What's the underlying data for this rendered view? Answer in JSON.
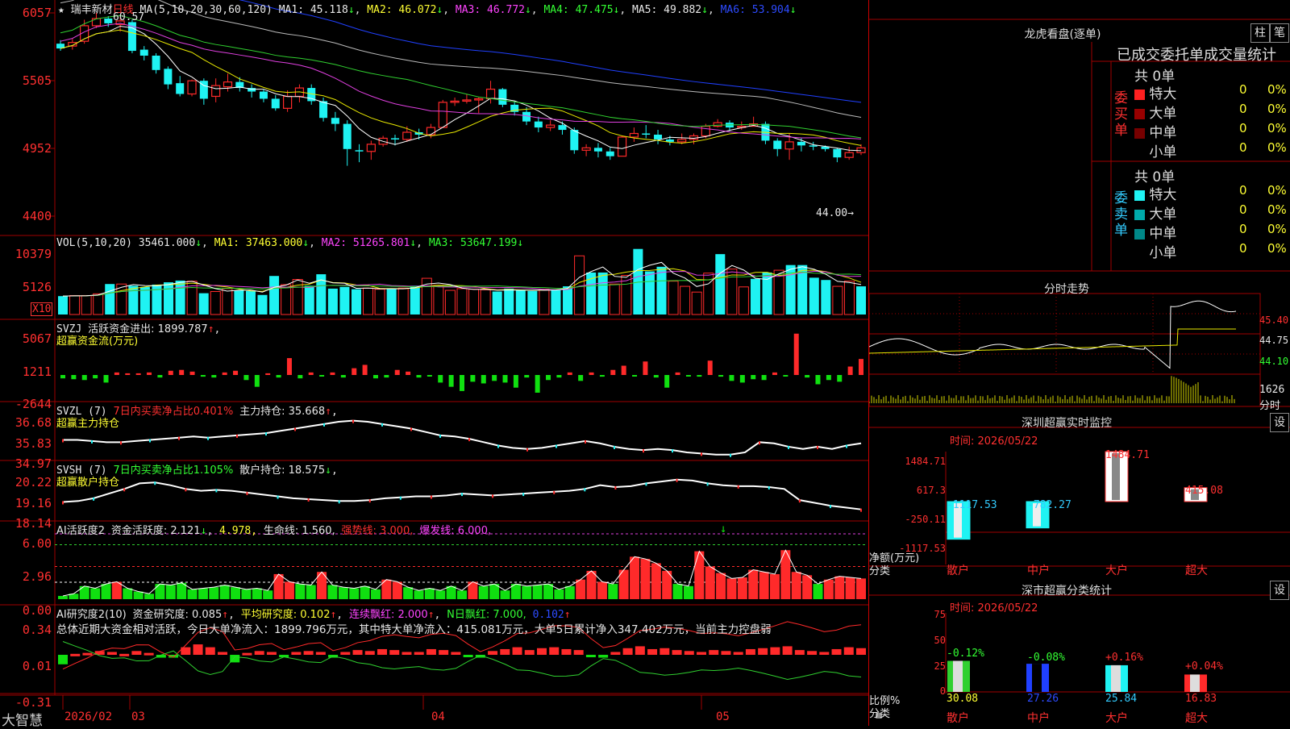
{
  "stock": {
    "name": "瑞丰新材",
    "period": "日线",
    "star": "★"
  },
  "colors": {
    "up": "#ff2a2a",
    "down": "#1ff3f3",
    "ma1": "#ffffff",
    "ma2": "#e8e800",
    "ma3": "#e040e0",
    "ma4": "#30d030",
    "ma5": "#bbbbbb",
    "ma6": "#2040ff",
    "grid": "#a00000"
  },
  "kline": {
    "header": {
      "ma_params": "MA(5,10,20,30,60,120)",
      "ma1": "MA1: 45.118",
      "ma2": "MA2: 46.072",
      "ma3": "MA3: 46.772",
      "ma4": "MA4: 47.475",
      "ma5": "MA5: 49.882",
      "ma6": "MA6: 53.904",
      "arrow": "↓"
    },
    "ylabels": [
      "6057",
      "5505",
      "4952",
      "4400"
    ],
    "high_label": "60.57",
    "low_label": "44.00→"
  },
  "vol": {
    "header": {
      "name": "VOL(5,10,20)",
      "v": "35461.000",
      "ma1": "MA1: 37463.000",
      "ma2": "MA2: 51265.801",
      "ma3": "MA3: 53647.199",
      "arrow": "↓"
    },
    "ylabels": [
      "10379",
      "5126"
    ],
    "unit": "X10"
  },
  "svzj": {
    "header": {
      "name": "SVZJ",
      "label": "活跃资金进出: 1899.787",
      "arrow": "↑",
      "sub": "超赢资金流(万元)"
    },
    "ylabels": [
      "5067",
      "1211",
      "-2644"
    ]
  },
  "svzl": {
    "header": {
      "name": "SVZL (7)",
      "label1": "7日内买卖净占比0.401%",
      "label2": "主力持仓: 35.668",
      "arrow": "↑",
      "comma": ",",
      "sub": "超赢主力持仓"
    },
    "ylabels": [
      "36.68",
      "35.83",
      "34.97"
    ]
  },
  "svsh": {
    "header": {
      "name": "SVSH (7)",
      "label1": "7日内买卖净占比1.105%",
      "label2": "散户持仓: 18.575",
      "arrow": "↓",
      "comma": ",",
      "sub": "超赢散户持仓"
    },
    "ylabels": [
      "20.22",
      "19.16",
      "18.14"
    ]
  },
  "ai1": {
    "header": {
      "name": "AI活跃度2",
      "label": "资金活跃度: 2.121",
      "arrow": "↓",
      "v2": "4.978,",
      "life": "生命线: 1.560,",
      "strong": "强势线: 3.000,",
      "burst": "爆发线: 6.000,"
    },
    "ylabels": [
      "6.00",
      "2.96",
      "0.00"
    ]
  },
  "ai2": {
    "header": {
      "name": "AI研究度2(10)",
      "label": "资金研究度: 0.085",
      "avg": "平均研究度: 0.102",
      "cont": "连续飘红: 2.000",
      "nday": "N日飘红: 7.000,",
      "last": "0.102",
      "arrow": "↑"
    },
    "summary": "总体近期大资金相对活跃，今日大单净流入：1899.796万元，其中特大单净流入：415.081万元，大单5日累计净入347.402万元，当前主力控盘弱",
    "ylabels": [
      "0.34",
      "0.01",
      "-0.31"
    ]
  },
  "xaxis": {
    "brand": "大智慧",
    "labels": [
      "2026/02",
      "03",
      "04",
      "05"
    ]
  },
  "right": {
    "dragon_title": "龙虎看盘(逐单)",
    "btn_zhu": "柱",
    "btn_bi": "笔",
    "stats_title": "已成交委托单成交量统计",
    "buy": {
      "side": "委买单",
      "total": "共 0单",
      "rows": [
        {
          "label": "特大",
          "v": "0",
          "p": "0%"
        },
        {
          "label": "大单",
          "v": "0",
          "p": "0%"
        },
        {
          "label": "中单",
          "v": "0",
          "p": "0%"
        },
        {
          "label": "小单",
          "v": "0",
          "p": "0%"
        }
      ]
    },
    "sell": {
      "side": "委卖单",
      "total": "共 0单",
      "rows": [
        {
          "label": "特大",
          "v": "0",
          "p": "0%"
        },
        {
          "label": "大单",
          "v": "0",
          "p": "0%"
        },
        {
          "label": "中单",
          "v": "0",
          "p": "0%"
        },
        {
          "label": "小单",
          "v": "0",
          "p": "0%"
        }
      ]
    },
    "intraday_title": "分时走势",
    "intraday_ylabels": [
      "45.40",
      "44.75",
      "44.10"
    ],
    "intraday_vol_label": "1626",
    "intraday_vol_unit": "分时",
    "monitor_title": "深圳超赢实时监控",
    "monitor_time": "时间: 2026/05/22",
    "monitor_ylabels": [
      "1484.71",
      "617.3",
      "-250.11",
      "-1117.53"
    ],
    "monitor_unit1": "净额(万元)",
    "monitor_unit2": "分类",
    "monitor_bars": [
      {
        "cat": "散户",
        "value": -1117.53,
        "label": "-1117.53"
      },
      {
        "cat": "中户",
        "value": -782.27,
        "label": "-782.27"
      },
      {
        "cat": "大户",
        "value": 1484.71,
        "label": "1484.71"
      },
      {
        "cat": "超大",
        "value": 415.08,
        "label": "415.08"
      }
    ],
    "class_title": "深市超赢分类统计",
    "class_time": "时间: 2026/05/22",
    "class_ylabels": [
      "75",
      "50",
      "25",
      "0"
    ],
    "class_unit1": "比例%",
    "class_unit2": "分类",
    "class_bars": [
      {
        "cat": "散户",
        "value": 30.08,
        "label": "30.08",
        "chg": "-0.12%"
      },
      {
        "cat": "中户",
        "value": 27.26,
        "label": "27.26",
        "chg": "-0.08%"
      },
      {
        "cat": "大户",
        "value": 25.84,
        "label": "25.84",
        "chg": "+0.16%"
      },
      {
        "cat": "超大",
        "value": 16.83,
        "label": "16.83",
        "chg": "+0.04%"
      }
    ],
    "btn_set": "设"
  },
  "chart_data": [
    {
      "type": "candlestick",
      "title": "瑞丰新材 日线",
      "ylim": [
        44.0,
        60.57
      ],
      "candles": [
        [
          58.0,
          57.6,
          58.3,
          57.4
        ],
        [
          57.8,
          58.1,
          58.4,
          57.5
        ],
        [
          58.2,
          59.5,
          60.0,
          58.0
        ],
        [
          59.5,
          60.1,
          60.57,
          59.3
        ],
        [
          60.1,
          59.7,
          60.3,
          59.4
        ],
        [
          59.6,
          59.9,
          60.2,
          59.0
        ],
        [
          59.8,
          57.4,
          60.0,
          57.2
        ],
        [
          57.5,
          57.0,
          57.8,
          56.6
        ],
        [
          57.0,
          55.8,
          57.2,
          55.5
        ],
        [
          55.9,
          54.6,
          56.1,
          54.2
        ],
        [
          54.7,
          53.8,
          55.3,
          53.6
        ],
        [
          53.8,
          54.9,
          55.0,
          53.6
        ],
        [
          54.9,
          53.4,
          55.1,
          52.9
        ],
        [
          53.6,
          54.5,
          55.1,
          53.1
        ],
        [
          54.4,
          54.8,
          55.5,
          54.0
        ],
        [
          54.8,
          54.3,
          55.2,
          54.0
        ],
        [
          54.3,
          54.0,
          54.6,
          53.5
        ],
        [
          54.0,
          53.4,
          54.2,
          53.1
        ],
        [
          53.4,
          52.6,
          53.7,
          52.4
        ],
        [
          52.6,
          53.6,
          54.1,
          52.3
        ],
        [
          53.6,
          54.3,
          54.6,
          53.1
        ],
        [
          54.3,
          53.2,
          54.6,
          52.9
        ],
        [
          53.2,
          51.8,
          53.5,
          51.5
        ],
        [
          51.8,
          51.3,
          52.3,
          50.7
        ],
        [
          51.3,
          49.2,
          51.6,
          47.8
        ],
        [
          49.1,
          49.0,
          49.6,
          48.1
        ],
        [
          49.0,
          49.6,
          49.9,
          48.3
        ],
        [
          49.6,
          50.1,
          50.3,
          49.4
        ],
        [
          50.1,
          50.0,
          50.4,
          49.5
        ],
        [
          50.0,
          50.6,
          51.1,
          49.8
        ],
        [
          50.6,
          50.4,
          50.9,
          50.0
        ],
        [
          50.4,
          51.0,
          51.3,
          50.1
        ],
        [
          51.0,
          53.1,
          53.3,
          51.0
        ],
        [
          53.1,
          53.2,
          53.5,
          52.8
        ],
        [
          53.2,
          53.3,
          53.8,
          53.0
        ],
        [
          53.3,
          53.4,
          53.5,
          52.2
        ],
        [
          53.4,
          54.2,
          54.9,
          53.0
        ],
        [
          54.2,
          52.9,
          54.3,
          52.7
        ],
        [
          52.9,
          52.3,
          53.2,
          52.0
        ],
        [
          52.3,
          51.5,
          52.7,
          51.2
        ],
        [
          51.5,
          51.0,
          51.9,
          50.6
        ],
        [
          51.0,
          51.2,
          51.6,
          50.7
        ],
        [
          51.2,
          50.8,
          51.5,
          50.4
        ],
        [
          50.8,
          49.1,
          51.0,
          48.8
        ],
        [
          49.1,
          49.3,
          49.6,
          48.6
        ],
        [
          49.3,
          49.0,
          49.7,
          48.5
        ],
        [
          49.0,
          48.6,
          49.3,
          48.3
        ],
        [
          48.6,
          50.2,
          50.3,
          48.6
        ],
        [
          50.2,
          50.5,
          51.0,
          49.8
        ],
        [
          50.5,
          50.4,
          51.2,
          50.1
        ],
        [
          50.4,
          50.0,
          50.8,
          49.6
        ],
        [
          50.0,
          49.8,
          50.3,
          49.5
        ],
        [
          49.8,
          50.0,
          50.5,
          49.6
        ],
        [
          50.0,
          50.3,
          50.5,
          49.6
        ],
        [
          50.3,
          51.1,
          51.3,
          50.1
        ],
        [
          51.1,
          51.4,
          51.7,
          51.0
        ],
        [
          51.4,
          51.0,
          51.6,
          50.7
        ],
        [
          51.0,
          51.1,
          51.5,
          50.8
        ],
        [
          51.1,
          51.3,
          51.9,
          51.1
        ],
        [
          51.3,
          49.9,
          51.5,
          49.6
        ],
        [
          49.9,
          49.2,
          50.1,
          48.6
        ],
        [
          49.2,
          49.8,
          50.5,
          48.3
        ],
        [
          49.8,
          49.5,
          50.1,
          49.0
        ],
        [
          49.5,
          49.4,
          49.8,
          49.1
        ],
        [
          49.4,
          49.2,
          49.5,
          49.0
        ],
        [
          49.2,
          48.5,
          49.3,
          48.1
        ],
        [
          48.5,
          48.9,
          49.4,
          48.3
        ],
        [
          48.9,
          49.3,
          49.6,
          48.7
        ]
      ],
      "ma_lines": [
        "MA1",
        "MA2",
        "MA3",
        "MA4",
        "MA5",
        "MA6"
      ]
    },
    {
      "type": "bar",
      "title": "VOL(5,10,20)",
      "values": [
        3.2,
        3.3,
        3.3,
        3.6,
        5.3,
        5.3,
        5.0,
        4.8,
        5.2,
        5.6,
        5.9,
        5.8,
        3.7,
        4.0,
        4.5,
        4.2,
        4.1,
        3.4,
        6.7,
        5.2,
        6.1,
        5.0,
        7.0,
        4.5,
        4.8,
        4.4,
        4.6,
        4.4,
        4.4,
        4.6,
        5.0,
        6.3,
        5.1,
        4.2,
        4.5,
        4.4,
        4.3,
        4.0,
        4.5,
        4.2,
        4.1,
        4.4,
        4.3,
        4.9,
        10.2,
        7.3,
        7.3,
        5.3,
        6.8,
        11.4,
        7.5,
        8.3,
        5.8,
        4.9,
        3.9,
        7.2,
        10.5,
        7.9,
        4.8,
        6.2,
        7.3,
        7.7,
        8.6,
        8.6,
        6.4,
        6.0,
        4.9,
        5.8,
        4.9
      ],
      "series": [
        {
          "name": "MA1"
        },
        {
          "name": "MA2"
        },
        {
          "name": "MA3"
        }
      ]
    },
    {
      "type": "bar",
      "title": "SVZJ 超赢资金流(万元)",
      "values": [
        -400,
        -500,
        -600,
        -400,
        -900,
        300,
        200,
        200,
        300,
        -300,
        500,
        600,
        400,
        -200,
        -300,
        300,
        500,
        -600,
        -1400,
        200,
        -300,
        2000,
        -400,
        300,
        -100,
        300,
        -300,
        800,
        1200,
        -400,
        -300,
        600,
        400,
        -300,
        -100,
        -900,
        -1400,
        -1900,
        -800,
        -1000,
        -700,
        -900,
        -1500,
        -300,
        -2100,
        -600,
        -300,
        300,
        -700,
        300,
        -200,
        600,
        1100,
        -100,
        1600,
        -300,
        -1500,
        300,
        -100,
        -200,
        1700,
        -200,
        -700,
        -900,
        -500,
        -600,
        300,
        -100,
        4900,
        -300,
        -1100,
        -600,
        -800,
        1000,
        1900
      ]
    },
    {
      "type": "line",
      "title": "SVZL 超赢主力持仓",
      "ylim": [
        34.97,
        36.68
      ],
      "values": [
        35.7,
        35.7,
        35.65,
        35.6,
        35.6,
        35.65,
        35.7,
        35.75,
        35.8,
        35.85,
        35.8,
        35.85,
        35.9,
        35.95,
        36.0,
        36.1,
        36.2,
        36.3,
        36.4,
        36.5,
        36.55,
        36.5,
        36.4,
        36.3,
        36.2,
        36.05,
        35.9,
        35.85,
        35.75,
        35.6,
        35.45,
        35.35,
        35.3,
        35.35,
        35.45,
        35.55,
        35.65,
        35.55,
        35.4,
        35.3,
        35.25,
        35.3,
        35.25,
        35.15,
        35.1,
        35.05,
        35.05,
        35.15,
        35.6,
        35.55,
        35.4,
        35.3,
        35.4,
        35.3,
        35.45,
        35.55
      ]
    },
    {
      "type": "line",
      "title": "SVSH 超赢散户持仓",
      "ylim": [
        18.14,
        20.22
      ],
      "values": [
        18.9,
        18.95,
        19.1,
        19.35,
        19.6,
        19.9,
        19.95,
        19.8,
        19.6,
        19.5,
        19.55,
        19.5,
        19.4,
        19.3,
        19.2,
        19.1,
        19.05,
        19.0,
        18.95,
        18.95,
        19.0,
        19.1,
        19.15,
        19.2,
        19.2,
        19.25,
        19.35,
        19.3,
        19.25,
        19.3,
        19.35,
        19.4,
        19.45,
        19.5,
        19.6,
        19.8,
        19.7,
        19.75,
        19.9,
        20.0,
        20.1,
        20.05,
        19.9,
        19.8,
        19.75,
        19.75,
        19.7,
        19.6,
        19.0,
        18.85,
        18.7,
        18.6,
        18.5
      ]
    },
    {
      "type": "bar",
      "title": "AI活跃度2",
      "ylim": [
        0,
        6
      ],
      "values": [
        0.3,
        0.5,
        1.2,
        1.0,
        1.4,
        1.6,
        1.0,
        0.7,
        0.5,
        1.4,
        1.3,
        1.5,
        0.9,
        1.0,
        1.1,
        1.3,
        1.1,
        0.9,
        1.0,
        0.8,
        2.3,
        1.6,
        1.4,
        1.3,
        2.5,
        1.3,
        1.1,
        1.0,
        1.2,
        0.9,
        1.8,
        1.6,
        1.1,
        0.8,
        1.0,
        0.8,
        1.2,
        0.8,
        1.6,
        1.2,
        1.4,
        0.8,
        1.4,
        1.2,
        1.3,
        1.4,
        0.9,
        1.2,
        1.8,
        2.6,
        1.6,
        1.4,
        2.7,
        3.9,
        3.7,
        3.3,
        2.6,
        1.4,
        1.2,
        4.4,
        3.0,
        2.4,
        1.9,
        2.0,
        2.7,
        2.5,
        2.3,
        4.5,
        2.5,
        2.2,
        1.4,
        1.8,
        2.1,
        2.0,
        1.9
      ]
    },
    {
      "type": "bar",
      "title": "AI研究度2(10)",
      "ylim": [
        -0.31,
        0.34
      ],
      "values": [
        -0.1,
        0.01,
        0.02,
        0.04,
        0.03,
        0.01,
        0.04,
        0.02,
        -0.03,
        -0.03,
        0.08,
        0.11,
        0.08,
        0.03,
        -0.08,
        0.02,
        0.04,
        0.03,
        -0.02,
        0.03,
        0.04,
        0.03,
        -0.03,
        0.03,
        0.05,
        0.04,
        0.06,
        0.05,
        0.03,
        0.03,
        0.06,
        0.05,
        0.03,
        -0.02,
        -0.03,
        0.04,
        0.06,
        0.08,
        0.05,
        0.07,
        0.08,
        0.06,
        0.05,
        -0.02,
        -0.03,
        0.03,
        0.07,
        0.09,
        0.06,
        0.07,
        0.05,
        0.04,
        0.03,
        0.05,
        0.04,
        0.03,
        0.06,
        0.07,
        0.08,
        0.09,
        0.05,
        0.04,
        0.03,
        0.06,
        0.08,
        0.07
      ]
    },
    {
      "type": "line",
      "title": "分时走势",
      "ylim": [
        44.1,
        45.4
      ]
    },
    {
      "type": "bar",
      "title": "深圳超赢实时监控",
      "categories": [
        "散户",
        "中户",
        "大户",
        "超大"
      ],
      "values": [
        -1117.53,
        -782.27,
        1484.71,
        415.08
      ],
      "ylim": [
        -1117.53,
        1484.71
      ],
      "xlabel": "分类",
      "ylabel": "净额(万元)"
    },
    {
      "type": "bar",
      "title": "深市超赢分类统计",
      "categories": [
        "散户",
        "中户",
        "大户",
        "超大"
      ],
      "values": [
        30.08,
        27.26,
        25.84,
        16.83
      ],
      "ylim": [
        0,
        75
      ],
      "xlabel": "分类",
      "ylabel": "比例%"
    }
  ]
}
